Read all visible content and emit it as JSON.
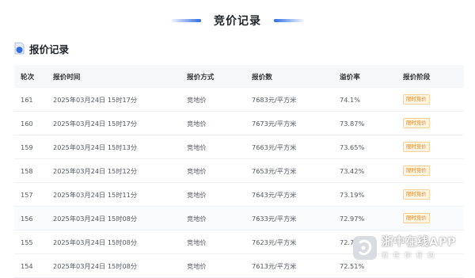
{
  "header": {
    "title": "竞价记录"
  },
  "section": {
    "title": "报价记录",
    "icon": "document-icon"
  },
  "table": {
    "columns": [
      "轮次",
      "报价时间",
      "报价方式",
      "报价数",
      "溢价率",
      "报价阶段"
    ],
    "rows": [
      {
        "round": "161",
        "time": "2025年03月24日 15时17分",
        "method": "竞地价",
        "amount": "7683元/平方米",
        "premium": "74.1%",
        "stage": "限时竞价"
      },
      {
        "round": "160",
        "time": "2025年03月24日 15时17分",
        "method": "竞地价",
        "amount": "7673元/平方米",
        "premium": "73.87%",
        "stage": "限时竞价"
      },
      {
        "round": "159",
        "time": "2025年03月24日 15时13分",
        "method": "竞地价",
        "amount": "7663元/平方米",
        "premium": "73.65%",
        "stage": "限时竞价"
      },
      {
        "round": "158",
        "time": "2025年03月24日 15时12分",
        "method": "竞地价",
        "amount": "7653元/平方米",
        "premium": "73.42%",
        "stage": "限时竞价"
      },
      {
        "round": "157",
        "time": "2025年03月24日 15时11分",
        "method": "竞地价",
        "amount": "7643元/平方米",
        "premium": "73.19%",
        "stage": "限时竞价"
      },
      {
        "round": "156",
        "time": "2025年03月24日 15时08分",
        "method": "竞地价",
        "amount": "7633元/平方米",
        "premium": "72.97%",
        "stage": "限时竞价"
      },
      {
        "round": "155",
        "time": "2025年03月24日 15时08分",
        "method": "竞地价",
        "amount": "7623元/平方米",
        "premium": "72.7",
        "stage": ""
      },
      {
        "round": "154",
        "time": "2025年03月24日 15时08分",
        "method": "竞地价",
        "amount": "7613元/平方米",
        "premium": "72.51%",
        "stage": ""
      }
    ]
  },
  "watermark": {
    "title": "浙中在线APP",
    "subtitle": "就在你身边"
  },
  "colors": {
    "accent": "#2f6ee6",
    "badge_text": "#e0841a",
    "badge_bg": "#fff4e0"
  }
}
